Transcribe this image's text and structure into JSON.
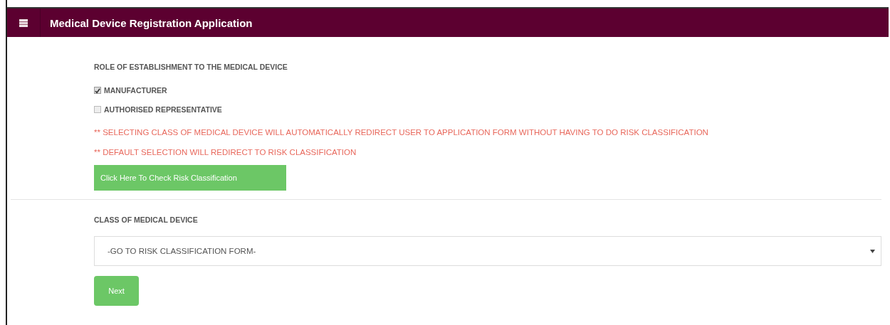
{
  "header": {
    "title": "Medical Device Registration Application"
  },
  "role": {
    "label": "ROLE OF ESTABLISHMENT TO THE MEDICAL DEVICE",
    "options": [
      {
        "label": "MANUFACTURER",
        "checked": true
      },
      {
        "label": "AUTHORISED REPRESENTATIVE",
        "checked": false
      }
    ]
  },
  "notes": [
    "** SELECTING CLASS OF MEDICAL DEVICE WILL AUTOMATICALLY REDIRECT USER TO APPLICATION FORM WITHOUT HAVING TO DO RISK CLASSIFICATION",
    "** DEFAULT SELECTION WILL REDIRECT TO RISK CLASSIFICATION"
  ],
  "risk_button": "Click Here To Check Risk Classification",
  "device_class": {
    "label": "CLASS OF MEDICAL DEVICE",
    "value": "-GO TO RISK CLASSIFICATION FORM-"
  },
  "next_button": "Next"
}
